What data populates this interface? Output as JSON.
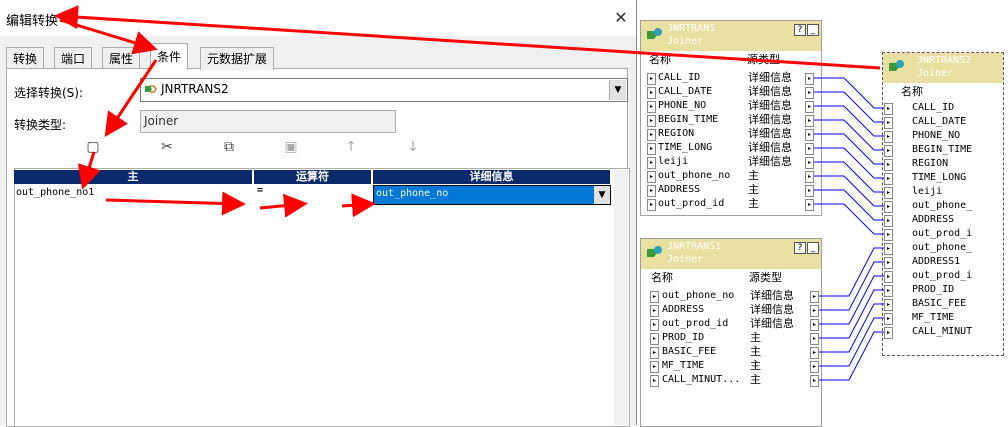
{
  "dialog": {
    "title": "编辑转换",
    "close": "✕",
    "tabs": [
      "转换",
      "端口",
      "属性",
      "条件",
      "元数据扩展"
    ],
    "active_tab": "条件",
    "select_label": "选择转换(S):",
    "select_value": "JNRTRANS2",
    "type_label": "转换类型:",
    "type_value": "Joiner",
    "toolbar": [
      "new-icon",
      "cut-icon",
      "copy-icon",
      "paste-icon",
      "up-arrow-icon",
      "down-arrow-icon"
    ],
    "grid": {
      "headers": [
        "主",
        "运算符",
        "详细信息"
      ],
      "row": {
        "master": "out_phone_no1",
        "operator": "=",
        "detail": "out_phone_no"
      }
    }
  },
  "joiners": [
    {
      "name": "JNRTRANS",
      "type": "Joiner",
      "col_name": "名称",
      "col_src": "源类型",
      "rows": [
        [
          "CALL_ID",
          "详细信息"
        ],
        [
          "CALL_DATE",
          "详细信息"
        ],
        [
          "PHONE_NO",
          "详细信息"
        ],
        [
          "BEGIN_TIME",
          "详细信息"
        ],
        [
          "REGION",
          "详细信息"
        ],
        [
          "TIME_LONG",
          "详细信息"
        ],
        [
          "leiji",
          "详细信息"
        ],
        [
          "out_phone_no",
          "主"
        ],
        [
          "ADDRESS",
          "主"
        ],
        [
          "out_prod_id",
          "主"
        ]
      ]
    },
    {
      "name": "JNRTRANS1",
      "type": "Joiner",
      "col_name": "名称",
      "col_src": "源类型",
      "rows": [
        [
          "out_phone_no",
          "详细信息"
        ],
        [
          "ADDRESS",
          "详细信息"
        ],
        [
          "out_prod_id",
          "详细信息"
        ],
        [
          "PROD_ID",
          "主"
        ],
        [
          "BASIC_FEE",
          "主"
        ],
        [
          "MF_TIME",
          "主"
        ],
        [
          "CALL_MINUT...",
          "主"
        ]
      ]
    },
    {
      "name": "JNRTRANS2",
      "type": "Joiner",
      "col_name": "名称",
      "rows": [
        "CALL_ID",
        "CALL_DATE",
        "PHONE_NO",
        "BEGIN_TIME",
        "REGION",
        "TIME_LONG",
        "leiji",
        "out_phone_",
        "ADDRESS",
        "out_prod_i",
        "out_phone_",
        "ADDRESS1",
        "out_prod_i",
        "PROD_ID",
        "BASIC_FEE",
        "MF_TIME",
        "CALL_MINUT"
      ]
    }
  ],
  "colors": {
    "header_bg": "#0a2a6b",
    "selection": "#0078d7",
    "annotation_arrow": "#ff0000",
    "link_line": "#0000ff",
    "joiner_title": "#e8e0a0"
  }
}
